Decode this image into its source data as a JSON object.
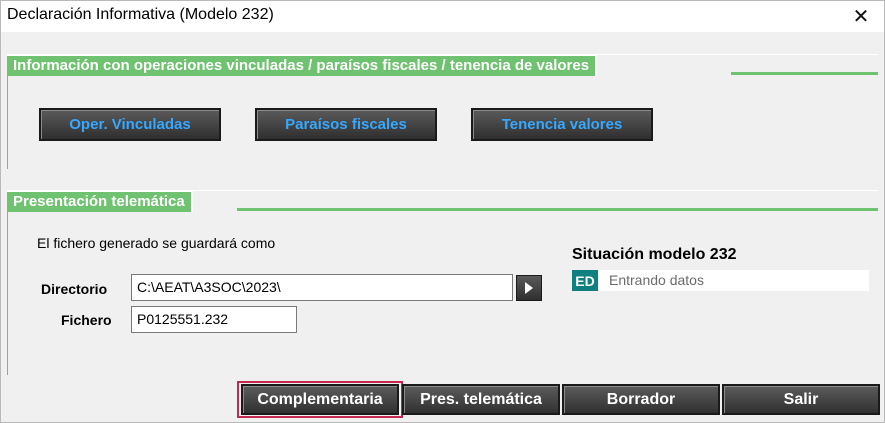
{
  "window": {
    "title": "Declaración Informativa (Modelo 232)",
    "close_label": "✕"
  },
  "info_section": {
    "header": "Información con operaciones vinculadas / paraísos fiscales / tenencia de valores",
    "buttons": [
      "Oper. Vinculadas",
      "Paraísos fiscales",
      "Tenencia valores"
    ]
  },
  "telematic_section": {
    "header": "Presentación telemática",
    "note": "El fichero generado se guardará como",
    "directorio_label": "Directorio",
    "directorio_value": "C:\\AEAT\\A3SOC\\2023\\",
    "fichero_label": "Fichero",
    "fichero_value": "P0125551.232"
  },
  "situation": {
    "title": "Situación modelo 232",
    "badge": "ED",
    "status": "Entrando datos"
  },
  "actions": {
    "complementaria": "Complementaria",
    "pres_telematica": "Pres. telemática",
    "borrador": "Borrador",
    "salir": "Salir"
  },
  "colors": {
    "section_green": "#6fc26f",
    "button_text_blue": "#36a8ff",
    "highlight_red": "#c4284f",
    "badge_teal": "#0f7f7f"
  }
}
